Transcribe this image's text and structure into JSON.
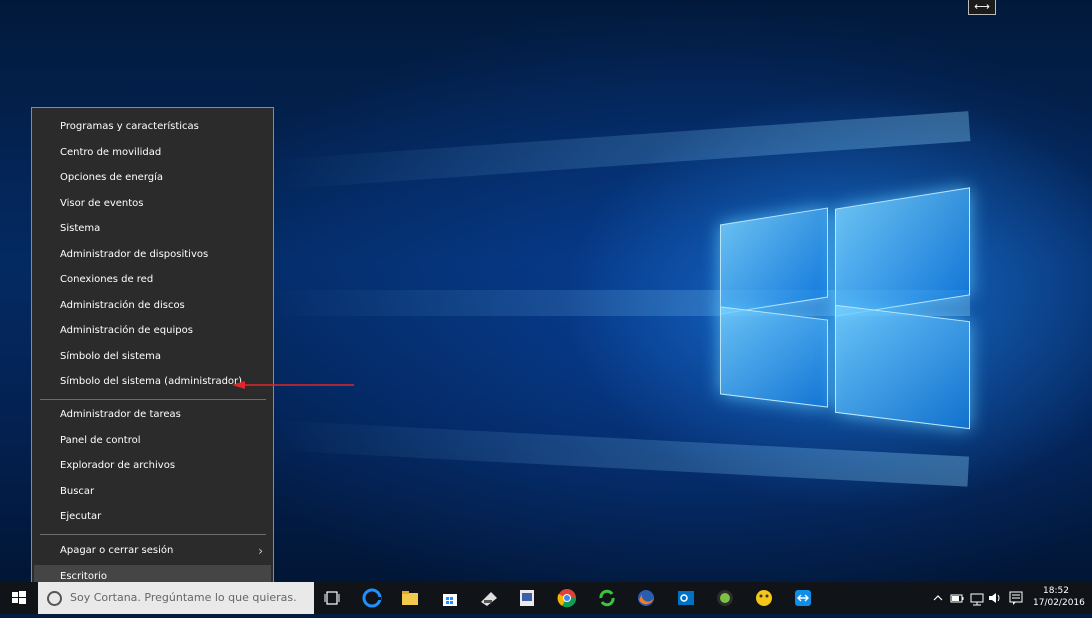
{
  "context_menu": {
    "items": [
      {
        "label": "Programas y características"
      },
      {
        "label": "Centro de movilidad"
      },
      {
        "label": "Opciones de energía"
      },
      {
        "label": "Visor de eventos"
      },
      {
        "label": "Sistema"
      },
      {
        "label": "Administrador de dispositivos"
      },
      {
        "label": "Conexiones de red"
      },
      {
        "label": "Administración de discos"
      },
      {
        "label": "Administración de equipos"
      },
      {
        "label": "Símbolo del sistema"
      },
      {
        "label": "Símbolo del sistema (administrador)"
      },
      {
        "label": "Administrador de tareas"
      },
      {
        "label": "Panel de control"
      },
      {
        "label": "Explorador de archivos"
      },
      {
        "label": "Buscar"
      },
      {
        "label": "Ejecutar"
      },
      {
        "label": "Apagar o cerrar sesión"
      },
      {
        "label": "Escritorio"
      }
    ],
    "submenu_indicator": "›",
    "annotation_arrow_color": "#e0262a"
  },
  "taskbar": {
    "search_placeholder": "Soy Cortana. Pregúntame lo que quieras.",
    "pinned_icons": [
      "task-view-icon",
      "edge-icon",
      "file-explorer-icon",
      "store-icon",
      "app-icon-1",
      "app-icon-2",
      "chrome-icon",
      "sync-app-icon",
      "firefox-icon",
      "outlook-icon",
      "app-icon-3",
      "app-icon-4",
      "teamviewer-icon"
    ],
    "clock_time": "18:52",
    "clock_date": "17/02/2016",
    "accent_color": "#1e90ff"
  },
  "desktop": {
    "sync_handle_label": "⟷"
  }
}
